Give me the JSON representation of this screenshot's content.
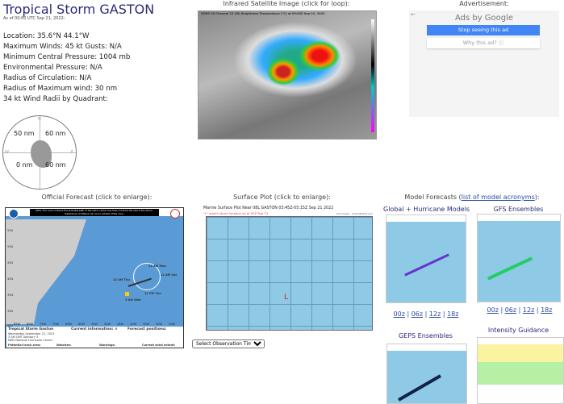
{
  "storm": {
    "title": "Tropical Storm GASTON",
    "as_of": "As of 00:00 UTC Sep 21, 2022:",
    "lines": [
      "Location: 35.6°N 44.1°W",
      "Maximum Winds: 45 kt  Gusts: N/A",
      "Minimum Central Pressure: 1004 mb",
      "Environmental Pressure: N/A",
      "Radius of Circulation: N/A",
      "Radius of Maximum wind: 30 nm",
      "34 kt Wind Radii by Quadrant:"
    ],
    "radii": {
      "ne": "60 nm",
      "nw": "50 nm",
      "sw": "0 nm",
      "se": "60 nm"
    },
    "compass": {
      "n": "N",
      "e": "E",
      "w": "W"
    }
  },
  "satellite": {
    "caption": "Infrared Satellite Image (click for loop):",
    "header": "GOES-16 Channel 13 (IR) Brightness Temperature (°C) at 05:00Z Sep 21, 2022"
  },
  "ad": {
    "caption": "Advertisement:",
    "ads_by": "Ads by Google",
    "stop": "Stop seeing this ad",
    "why": "Why this ad? ⓘ"
  },
  "official": {
    "caption": "Official Forecast (click to enlarge):",
    "note": "Note: The cone contains the probable path of the storm center but does not show the size of the storm. Hazardous conditions can occur outside of the cone.",
    "labels": [
      "12 AM Mon",
      "12 AM Sat",
      "12 AM Thu",
      "12 PM Thu",
      "3 AM Wed"
    ],
    "lats": [
      "55N",
      "50N",
      "45N",
      "40N",
      "35N",
      "30N",
      "25N"
    ],
    "lons": [
      "85W",
      "80W",
      "75W",
      "70W",
      "65W",
      "60W",
      "55W",
      "50W",
      "45W",
      "40W",
      "35W",
      "30W",
      "25W"
    ],
    "legend_title": "Tropical Storm Gaston",
    "legend_date": "Wednesday September 21, 2022",
    "legend_adv": "3 AM GMT Advisory 3",
    "legend_nhc": "NWS National Hurricane Center",
    "current": "Current information: ×",
    "forecast_pos": "Forecast positions:",
    "track_area": "Potential track area:",
    "watches": "Watches:",
    "warnings": "Warnings:",
    "wind_extent": "Current wind extent:"
  },
  "surface": {
    "caption": "Surface Plot (click to enlarge):",
    "title": "Marine Surface Plot Near 08L GASTON 03:45Z-05:15Z Sep 21 2022",
    "subtitle": "\"L\" marks storm location as of 00Z Sep 21",
    "credit": "Levi Cowan - tropicaltidbits.com",
    "marker": "L",
    "select": "Select Observation Time..."
  },
  "models": {
    "caption_pre": "Model Forecasts (",
    "link": "list of model acronyms",
    "caption_post": "):",
    "global": "Global + Hurricane Models",
    "gfs": "GFS Ensembles",
    "geps": "GEPS Ensembles",
    "intensity": "Intensity Guidance",
    "cycles": [
      "00z",
      "06z",
      "12z",
      "18z"
    ],
    "sep": "|"
  },
  "colors": {
    "title": "#2a2a7a",
    "ocean": "#8ecae6",
    "link": "#2a4aa0",
    "ad_button": "#4285f4"
  }
}
